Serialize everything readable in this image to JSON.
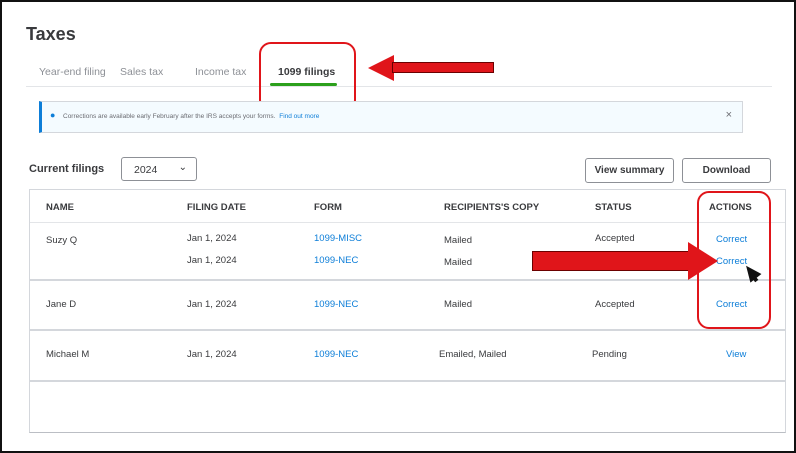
{
  "page": {
    "title": "Taxes"
  },
  "tabs": [
    {
      "label": "Year-end filing"
    },
    {
      "label": "Sales tax"
    },
    {
      "label": "Income tax"
    },
    {
      "label": "1099 filings",
      "active": true
    }
  ],
  "banner": {
    "icon": "lightbulb-icon",
    "text": "Corrections are available early February after the IRS accepts your forms.",
    "link": "Find out more",
    "close": "×"
  },
  "filings": {
    "label": "Current filings",
    "year": "2024",
    "chevron": "⌄",
    "view_summary": "View summary",
    "download": "Download"
  },
  "table": {
    "headers": [
      "NAME",
      "FILING DATE",
      "FORM",
      "RECIPIENTS'S COPY",
      "STATUS",
      "ACTIONS"
    ],
    "rows": [
      {
        "name": "Suzy Q",
        "date": "Jan 1, 2024",
        "form": "1099-MISC",
        "copy": "Mailed",
        "status": "Accepted",
        "action": "Correct"
      },
      {
        "name": "",
        "date": "Jan 1, 2024",
        "form": "1099-NEC",
        "copy": "Mailed",
        "status": "",
        "action": "Correct"
      },
      {
        "name": "Jane D",
        "date": "Jan 1, 2024",
        "form": "1099-NEC",
        "copy": "Mailed",
        "status": "Accepted",
        "action": "Correct"
      },
      {
        "name": "Michael M",
        "date": "Jan 1, 2024",
        "form": "1099-NEC",
        "copy": "Emailed, Mailed",
        "status": "Pending",
        "action": "View"
      }
    ]
  },
  "colors": {
    "accent_green": "#2ca01c",
    "link_blue": "#0d7ed8",
    "annotation_red": "#e0151a"
  }
}
